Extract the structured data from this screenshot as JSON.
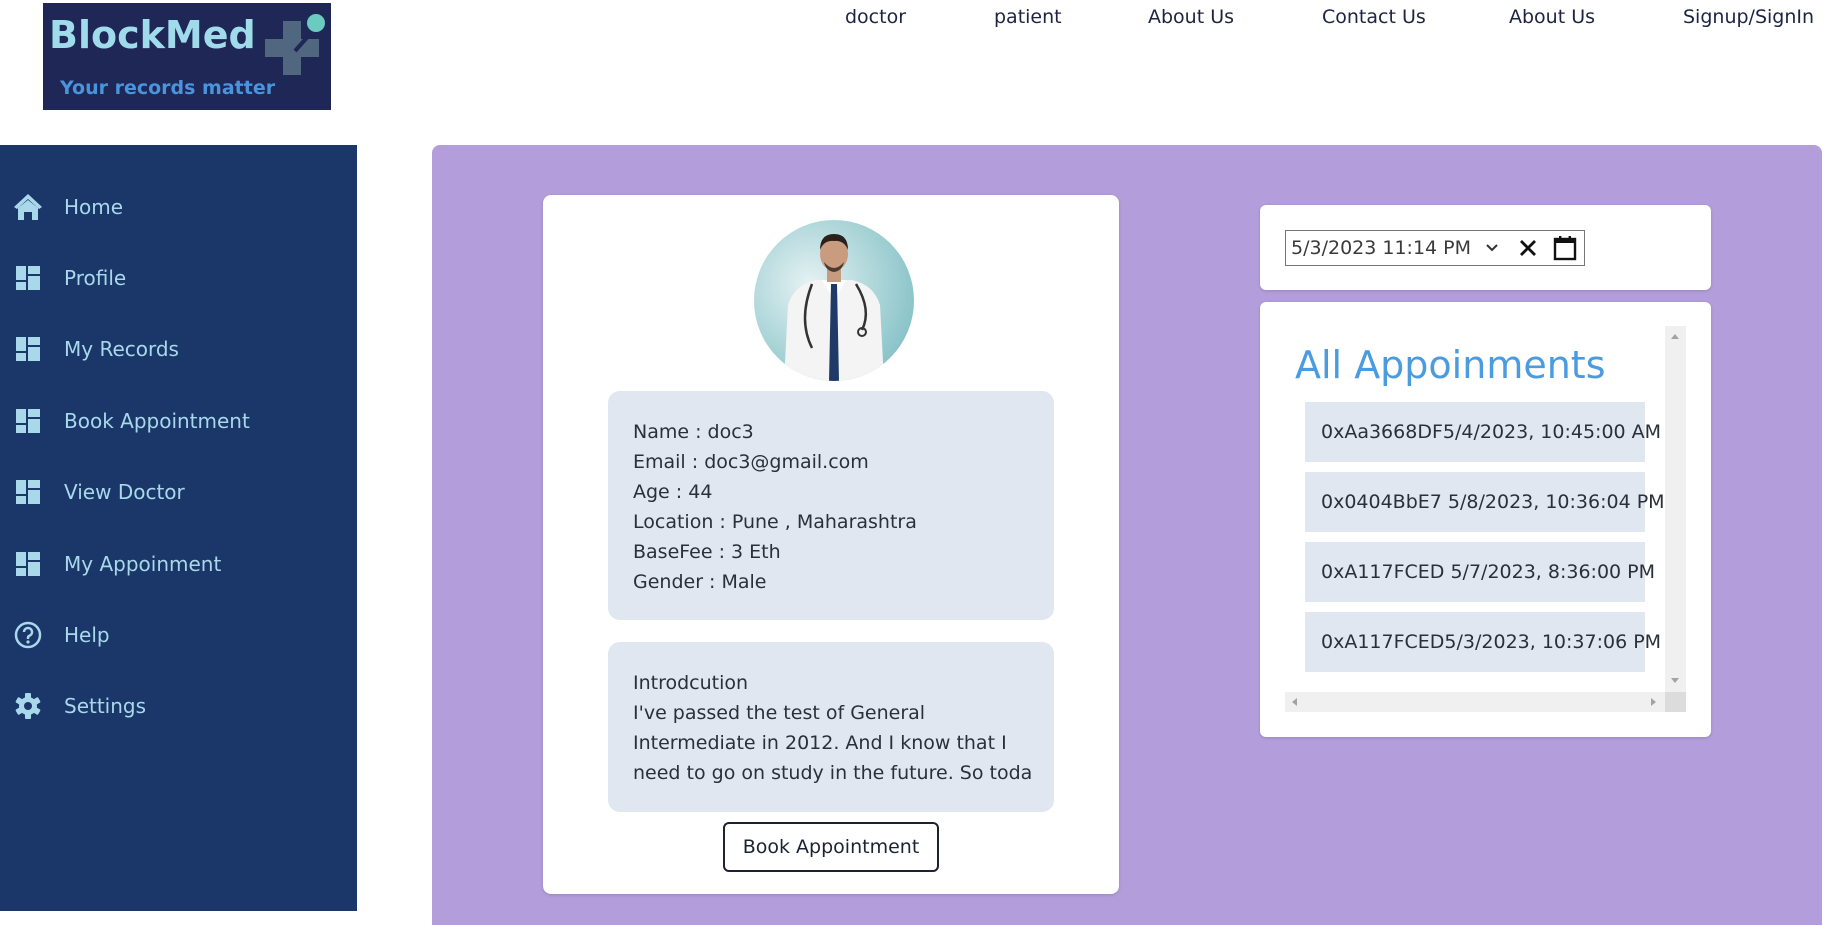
{
  "logo": {
    "brand": "BlockMed",
    "tagline": "Your records matter",
    "colors": {
      "background": "#1e2756",
      "brand_text": "#9fdbea",
      "tagline_text": "#4a94dc"
    }
  },
  "topnav": {
    "items": [
      {
        "label": "doctor"
      },
      {
        "label": "patient"
      },
      {
        "label": "About Us"
      },
      {
        "label": "Contact Us"
      },
      {
        "label": "About Us"
      },
      {
        "label": "Signup/SignIn"
      }
    ]
  },
  "sidebar": {
    "background": "#1b3668",
    "text_color": "#a8d8ea",
    "items": [
      {
        "label": "Home",
        "icon": "home-icon"
      },
      {
        "label": "Profile",
        "icon": "dashboard-icon"
      },
      {
        "label": "My Records",
        "icon": "dashboard-icon"
      },
      {
        "label": "Book Appointment",
        "icon": "dashboard-icon"
      },
      {
        "label": "View Doctor",
        "icon": "dashboard-icon"
      },
      {
        "label": "My Appoinment",
        "icon": "dashboard-icon"
      },
      {
        "label": "Help",
        "icon": "help-circle-icon"
      },
      {
        "label": "Settings",
        "icon": "gear-icon"
      }
    ]
  },
  "main": {
    "panel_color": "#b39ddb",
    "doctor": {
      "avatar": "doctor-photo",
      "info": [
        "Name : doc3",
        "Email : doc3@gmail.com",
        "Age : 44",
        "Location : Pune , Maharashtra",
        "BaseFee : 3 Eth",
        "Gender : Male"
      ],
      "intro_title": "Introdcution",
      "intro_text": "I've passed the test of General Intermediate in 2012. And I know that I need to go on study in the future. So toda",
      "book_button": "Book Appointment"
    },
    "datetime": {
      "value": "5/3/2023  11:14  PM"
    },
    "appointments": {
      "title": "All Appoinments",
      "title_color": "#4a9be0",
      "items": [
        "0xAa3668DF5/4/2023, 10:45:00 AM",
        "0x0404BbE7 5/8/2023, 10:36:04 PM",
        "0xA117FCED  5/7/2023, 8:36:00 PM",
        "0xA117FCED5/3/2023, 10:37:06 PM"
      ]
    }
  }
}
